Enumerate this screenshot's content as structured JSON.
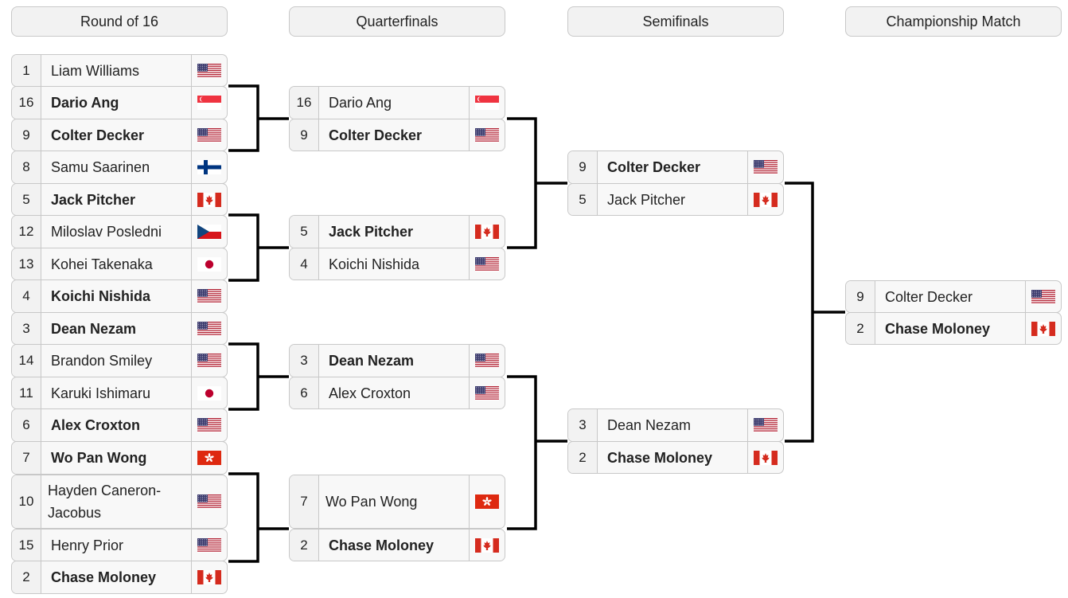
{
  "rounds": [
    "Round of 16",
    "Quarterfinals",
    "Semifinals",
    "Championship Match"
  ],
  "round_of_16": [
    {
      "seed": "1",
      "name": "Liam Williams",
      "flag": "usa-flag",
      "winner": false
    },
    {
      "seed": "16",
      "name": "Dario Ang",
      "flag": "singapore-flag",
      "winner": true
    },
    {
      "seed": "9",
      "name": "Colter Decker",
      "flag": "usa-flag",
      "winner": true
    },
    {
      "seed": "8",
      "name": "Samu Saarinen",
      "flag": "finland-flag",
      "winner": false
    },
    {
      "seed": "5",
      "name": "Jack Pitcher",
      "flag": "canada-flag",
      "winner": true
    },
    {
      "seed": "12",
      "name": "Miloslav Posledni",
      "flag": "czech-flag",
      "winner": false
    },
    {
      "seed": "13",
      "name": "Kohei Takenaka",
      "flag": "japan-flag",
      "winner": false
    },
    {
      "seed": "4",
      "name": "Koichi Nishida",
      "flag": "usa-flag",
      "winner": true
    },
    {
      "seed": "3",
      "name": "Dean Nezam",
      "flag": "usa-flag",
      "winner": true
    },
    {
      "seed": "14",
      "name": "Brandon Smiley",
      "flag": "usa-flag",
      "winner": false
    },
    {
      "seed": "11",
      "name": "Karuki Ishimaru",
      "flag": "japan-flag",
      "winner": false
    },
    {
      "seed": "6",
      "name": "Alex Croxton",
      "flag": "usa-flag",
      "winner": true
    },
    {
      "seed": "7",
      "name": "Wo Pan Wong",
      "flag": "hongkong-flag",
      "winner": true
    },
    {
      "seed": "10",
      "name": "Hayden Caneron-Jacobus",
      "flag": "usa-flag",
      "winner": false
    },
    {
      "seed": "15",
      "name": "Henry Prior",
      "flag": "usa-flag",
      "winner": false
    },
    {
      "seed": "2",
      "name": "Chase Moloney",
      "flag": "canada-flag",
      "winner": true
    }
  ],
  "quarterfinals": [
    {
      "seed": "16",
      "name": "Dario Ang",
      "flag": "singapore-flag",
      "winner": false
    },
    {
      "seed": "9",
      "name": "Colter Decker",
      "flag": "usa-flag",
      "winner": true
    },
    {
      "seed": "5",
      "name": "Jack Pitcher",
      "flag": "canada-flag",
      "winner": true
    },
    {
      "seed": "4",
      "name": "Koichi Nishida",
      "flag": "usa-flag",
      "winner": false
    },
    {
      "seed": "3",
      "name": "Dean Nezam",
      "flag": "usa-flag",
      "winner": true
    },
    {
      "seed": "6",
      "name": "Alex Croxton",
      "flag": "usa-flag",
      "winner": false
    },
    {
      "seed": "7",
      "name": "Wo Pan Wong",
      "flag": "hongkong-flag",
      "winner": false
    },
    {
      "seed": "2",
      "name": "Chase Moloney",
      "flag": "canada-flag",
      "winner": true
    }
  ],
  "semifinals": [
    {
      "seed": "9",
      "name": "Colter Decker",
      "flag": "usa-flag",
      "winner": true
    },
    {
      "seed": "5",
      "name": "Jack Pitcher",
      "flag": "canada-flag",
      "winner": false
    },
    {
      "seed": "3",
      "name": "Dean Nezam",
      "flag": "usa-flag",
      "winner": false
    },
    {
      "seed": "2",
      "name": "Chase Moloney",
      "flag": "canada-flag",
      "winner": true
    }
  ],
  "championship": [
    {
      "seed": "9",
      "name": "Colter Decker",
      "flag": "usa-flag",
      "winner": false
    },
    {
      "seed": "2",
      "name": "Chase Moloney",
      "flag": "canada-flag",
      "winner": true
    }
  ]
}
